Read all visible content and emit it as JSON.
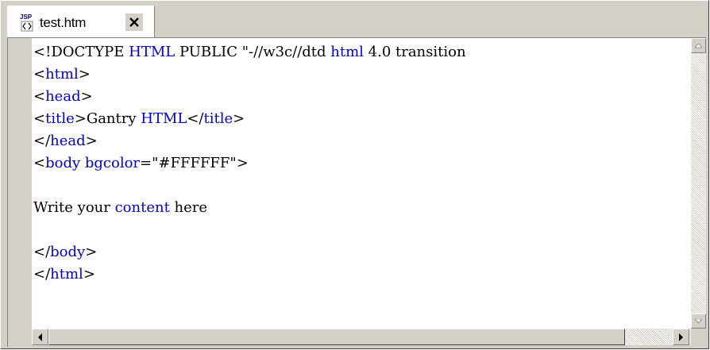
{
  "tab": {
    "icon": "jsp-file-icon",
    "icon_badge": "JSP",
    "label": "test.htm",
    "close_icon": "close-icon"
  },
  "editor": {
    "keyword_color": "#0000cc",
    "text_color": "#000000",
    "lines": [
      [
        {
          "t": "<!DOCTYPE ",
          "k": false
        },
        {
          "t": "HTML",
          "k": true
        },
        {
          "t": " PUBLIC \"-//w3c//dtd ",
          "k": false
        },
        {
          "t": "html",
          "k": true
        },
        {
          "t": " 4.0 transition",
          "k": false
        }
      ],
      [
        {
          "t": "<",
          "k": false
        },
        {
          "t": "html",
          "k": true
        },
        {
          "t": ">",
          "k": false
        }
      ],
      [
        {
          "t": "<",
          "k": false
        },
        {
          "t": "head",
          "k": true
        },
        {
          "t": ">",
          "k": false
        }
      ],
      [
        {
          "t": "<",
          "k": false
        },
        {
          "t": "title",
          "k": true
        },
        {
          "t": ">Gantry ",
          "k": false
        },
        {
          "t": "HTML",
          "k": true
        },
        {
          "t": "</",
          "k": false
        },
        {
          "t": "title",
          "k": true
        },
        {
          "t": ">",
          "k": false
        }
      ],
      [
        {
          "t": "</",
          "k": false
        },
        {
          "t": "head",
          "k": true
        },
        {
          "t": ">",
          "k": false
        }
      ],
      [
        {
          "t": "<",
          "k": false
        },
        {
          "t": "body bgcolor",
          "k": true
        },
        {
          "t": "=\"#FFFFFF\">",
          "k": false
        }
      ],
      [],
      [
        {
          "t": "Write your ",
          "k": false
        },
        {
          "t": "content",
          "k": true
        },
        {
          "t": " here",
          "k": false
        }
      ],
      [],
      [
        {
          "t": "</",
          "k": false
        },
        {
          "t": "body",
          "k": true
        },
        {
          "t": ">",
          "k": false
        }
      ],
      [
        {
          "t": "</",
          "k": false
        },
        {
          "t": "html",
          "k": true
        },
        {
          "t": ">",
          "k": false
        }
      ]
    ]
  },
  "scrollbars": {
    "up_icon": "arrow-up-icon",
    "down_icon": "arrow-down-icon",
    "left_icon": "arrow-left-icon",
    "right_icon": "arrow-right-icon"
  }
}
